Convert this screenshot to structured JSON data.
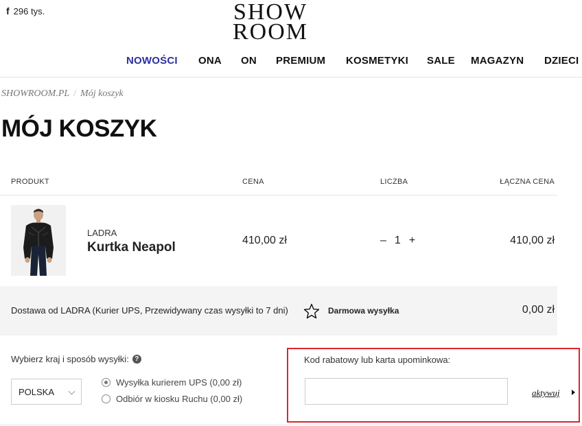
{
  "header": {
    "facebook": {
      "icon": "facebook-icon",
      "glyph": "f",
      "count": "296 tys."
    },
    "logo": {
      "line1": "SHOW",
      "line2": "ROOM"
    },
    "nav": [
      {
        "label": "NOWOŚCI",
        "active": true
      },
      {
        "label": "ONA"
      },
      {
        "label": "ON"
      },
      {
        "label": "PREMIUM"
      },
      {
        "label": "KOSMETYKI"
      },
      {
        "label": "SALE"
      },
      {
        "label": "MAGAZYN"
      },
      {
        "label": "DZIECI"
      }
    ]
  },
  "breadcrumb": {
    "home": "SHOWROOM.PL",
    "sep": "/",
    "current": "Mój koszyk"
  },
  "page_title": "MÓJ KOSZYK",
  "table": {
    "headers": {
      "product": "PRODUKT",
      "price": "CENA",
      "qty": "LICZBA",
      "total": "ŁĄCZNA CENA"
    }
  },
  "item": {
    "brand": "LADRA",
    "name": "Kurtka Neapol",
    "price": "410,00 zł",
    "qty_minus": "–",
    "qty": "1",
    "qty_plus": "+",
    "total": "410,00 zł"
  },
  "delivery": {
    "description": "Dostawa od LADRA (Kurier UPS, Przewidywany czas wysyłki to 7 dni)",
    "icon": "star-icon",
    "free_label": "Darmowa wysyłka",
    "price": "0,00 zł"
  },
  "shipping": {
    "label": "Wybierz kraj i sposób wysyłki:",
    "help_glyph": "?",
    "country": "POLSKA",
    "options": [
      {
        "label": "Wysyłka kurierem UPS (0,00 zł)",
        "selected": true
      },
      {
        "label": "Odbiór w kiosku Ruchu (0,00 zł)",
        "selected": false
      }
    ]
  },
  "coupon": {
    "label": "Kod rabatowy lub karta upominkowa:",
    "value": "",
    "placeholder": "",
    "activate": "aktywuj"
  },
  "colors": {
    "accent_nav": "#2b2fa0",
    "highlight_border": "#d9262c",
    "band_bg": "#f4f4f4"
  }
}
